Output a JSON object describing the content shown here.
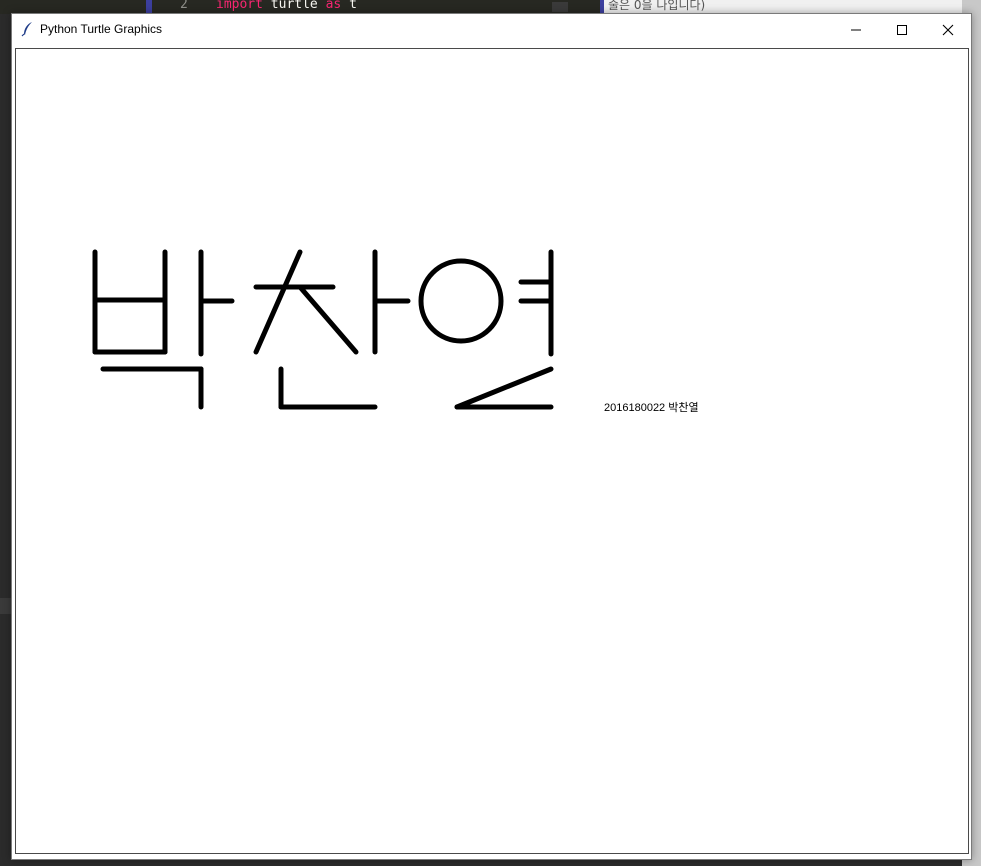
{
  "background": {
    "editor_line_number": "2",
    "editor_code_keyword": "import",
    "editor_code_module": "turtle",
    "editor_code_as": "as",
    "editor_code_alias": "t",
    "right_panel_text": "줄은 0을 나입니다)"
  },
  "window": {
    "title": "Python Turtle Graphics",
    "controls": {
      "minimize": "minimize-icon",
      "maximize": "maximize-icon",
      "close": "close-icon"
    }
  },
  "canvas": {
    "stroke_color": "#000000",
    "background_color": "#ffffff",
    "drawn_text": "박찬열",
    "caption": "2016180022 박찬열"
  }
}
